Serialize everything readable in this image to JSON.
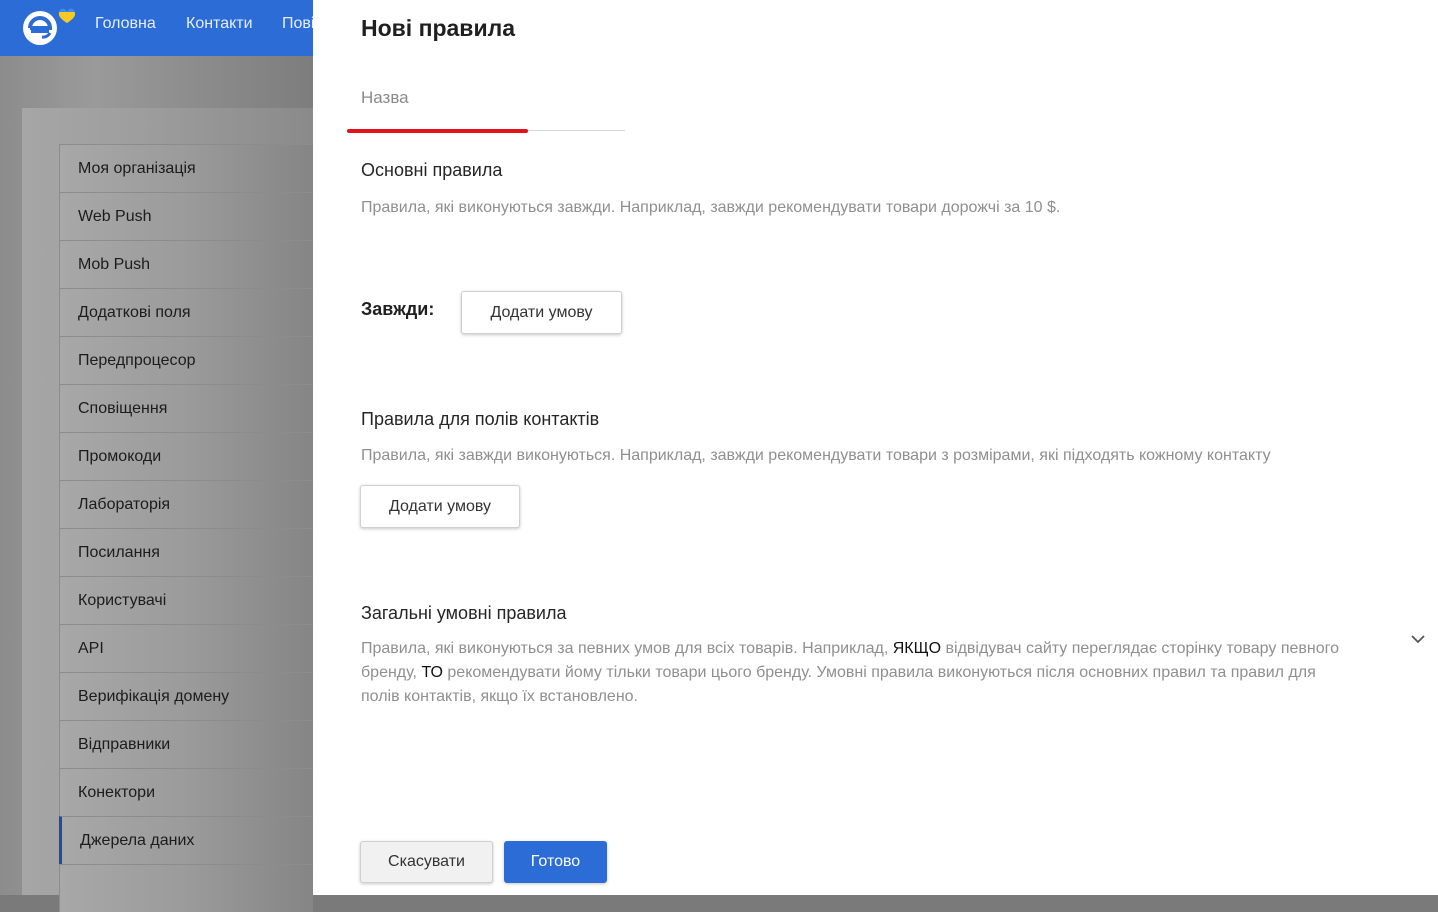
{
  "topbar": {
    "nav": [
      "Головна",
      "Контакти",
      "Пові"
    ]
  },
  "sidebar": {
    "items": [
      "Моя організація",
      "Web Push",
      "Mob Push",
      "Додаткові поля",
      "Передпроцесор",
      "Сповіщення",
      "Промокоди",
      "Лабораторія",
      "Посилання",
      "Користувачі",
      "API",
      "Верифікація домену",
      "Відправники",
      "Конектори",
      "Джерела даних"
    ],
    "active_item": "Джерела даних"
  },
  "drawer": {
    "title": "Нові правила",
    "name_placeholder": "Назва",
    "name_value": "",
    "name_progress": 0.65,
    "basic": {
      "title": "Основні правила",
      "desc": "Правила, які виконуються завжди. Наприклад, завжди рекомендувати товари дорожчі за 10 $.",
      "always_label": "Завжди:",
      "add_button": "Додати умову"
    },
    "contacts": {
      "title": "Правила для полів контактів",
      "desc": "Правила, які завжди виконуються. Наприклад, завжди рекомендувати товари з розмірами, які підходять кожному контакту",
      "add_button": "Додати умову"
    },
    "conditional": {
      "title": "Загальні умовні правила",
      "desc_1": "Правила, які виконуються за певних умов для всіх товарів. Наприклад,",
      "if_word": "ЯКЩО",
      "desc_2": "відвідувач сайту переглядає сторінку товару певного бренду,",
      "then_word": "ТО",
      "desc_3": "рекомендувати йому тільки товари цього бренду. Умовні правила виконуються після основних правил та правил для полів контактів, якщо їх встановлено."
    },
    "footer": {
      "cancel": "Скасувати",
      "done": "Готово"
    }
  },
  "colors": {
    "brand_blue": "#2c6cd6",
    "progress_red": "#e3131c"
  }
}
